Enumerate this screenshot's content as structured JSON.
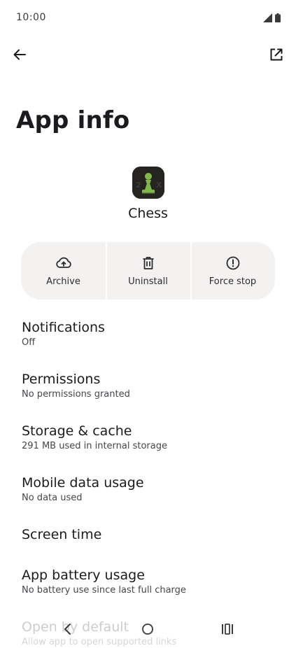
{
  "status_bar": {
    "time": "10:00"
  },
  "top_bar": {
    "back_icon": "arrow-back-icon",
    "open_icon": "open-in-new-icon"
  },
  "page": {
    "title": "App info"
  },
  "app": {
    "name": "Chess",
    "icon": "chess-pawn-icon",
    "icon_bg": "#262421",
    "icon_fg": "#81b64c"
  },
  "actions": [
    {
      "label": "Archive",
      "icon": "cloud-upload-icon"
    },
    {
      "label": "Uninstall",
      "icon": "trash-icon"
    },
    {
      "label": "Force stop",
      "icon": "alert-circle-icon"
    }
  ],
  "settings": {
    "notifications": {
      "title": "Notifications",
      "subtitle": "Off"
    },
    "permissions": {
      "title": "Permissions",
      "subtitle": "No permissions granted"
    },
    "storage": {
      "title": "Storage & cache",
      "subtitle": "291 MB used in internal storage"
    },
    "mobile_data": {
      "title": "Mobile data usage",
      "subtitle": "No data used"
    },
    "screen_time": {
      "title": "Screen time"
    },
    "battery": {
      "title": "App battery usage",
      "subtitle": "No battery use since last full charge"
    },
    "open_by_default": {
      "title": "Open by default",
      "subtitle": "Allow app to open supported links"
    }
  },
  "nav_bar": {
    "back_icon": "nav-back-icon",
    "home_icon": "nav-home-icon",
    "recents_icon": "nav-recents-icon"
  },
  "colors": {
    "background": "#ffffff",
    "action_bar_bg": "#f4f2f0",
    "text_primary": "#1b1b1f",
    "text_secondary": "#44464a"
  }
}
